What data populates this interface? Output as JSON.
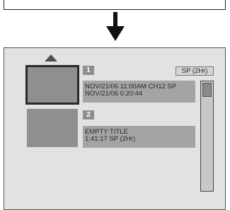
{
  "titles": [
    {
      "number": "1",
      "line1": "NOV/21/06  11:00AM CH12  SP",
      "line2": "NOV/21/06    0:20:44"
    },
    {
      "number": "2",
      "line1": "EMPTY TITLE",
      "line2": "1:41:17   SP (2Hr)"
    }
  ],
  "recording_mode": "SP (2Hr)",
  "icons": {
    "down": "down-arrow-icon",
    "up": "up-arrow-icon"
  },
  "colors": {
    "screen_background": "#e2e2e2",
    "thumbnail": "#8f8f8f",
    "info_box": "#a4a4a4",
    "selected_border": "#2a2a2a"
  }
}
